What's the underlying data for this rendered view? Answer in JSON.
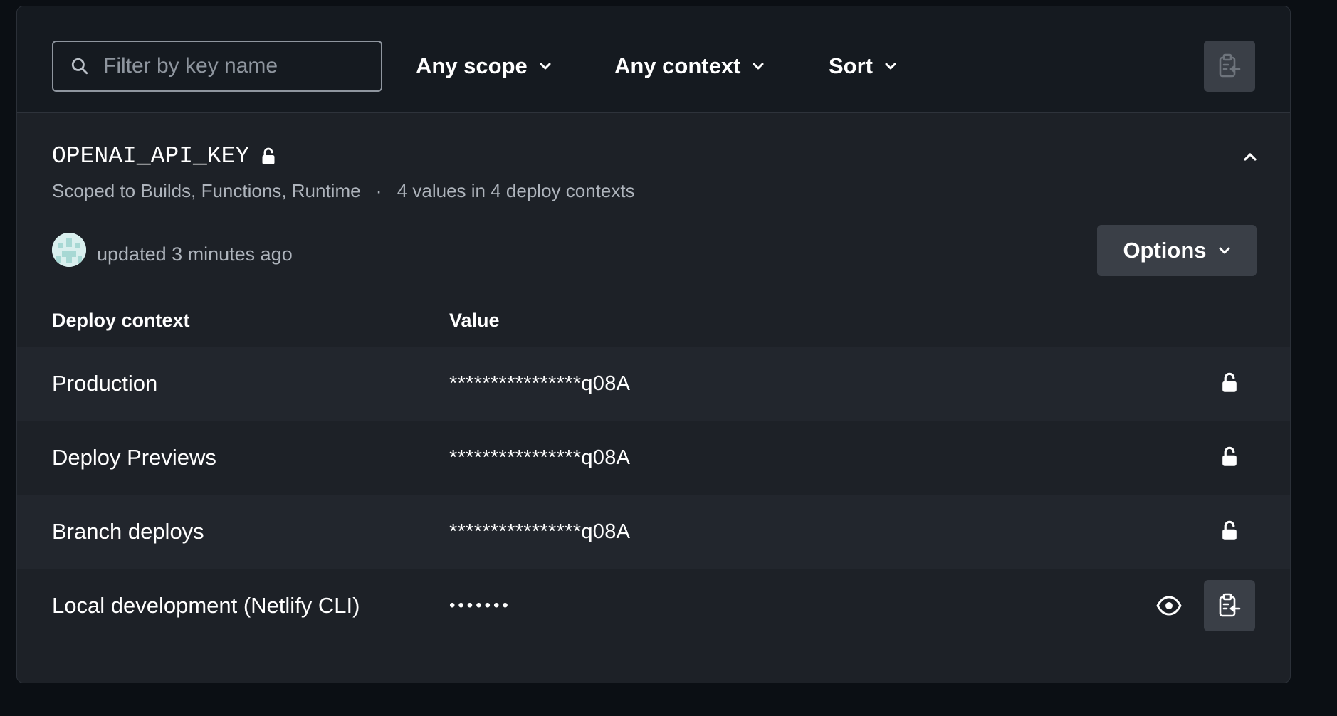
{
  "toolbar": {
    "search_placeholder": "Filter by key name",
    "scope_label": "Any scope",
    "context_label": "Any context",
    "sort_label": "Sort",
    "icons": {
      "search": "search-icon",
      "import": "clipboard-import-icon"
    }
  },
  "variable": {
    "key": "OPENAI_API_KEY",
    "scopes_text": "Scoped to Builds, Functions, Runtime",
    "separator": "·",
    "contexts_text": "4 values in 4 deploy contexts",
    "updated_text": "updated 3 minutes ago",
    "options_label": "Options",
    "table": {
      "headers": [
        "Deploy context",
        "Value"
      ],
      "rows": [
        {
          "context": "Production",
          "value": "****************q08A"
        },
        {
          "context": "Deploy Previews",
          "value": "****************q08A"
        },
        {
          "context": "Branch deploys",
          "value": "****************q08A"
        },
        {
          "context": "Local development (Netlify CLI)",
          "value": "•••••••"
        }
      ]
    }
  },
  "colors": {
    "panel": "#1d2127",
    "toolbar": "#151a20",
    "row_alt": "#22262d",
    "button": "#3a3f47",
    "muted_text": "#aeb4bc"
  }
}
